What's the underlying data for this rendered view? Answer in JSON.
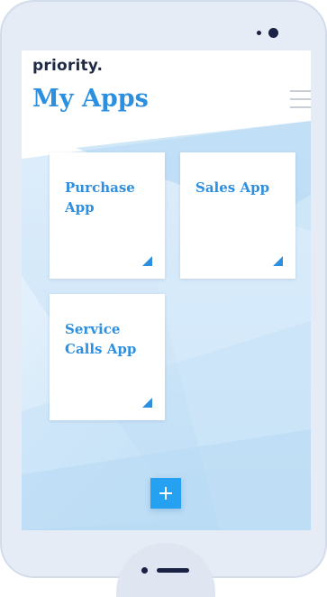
{
  "app": {
    "logo_text": "priority.",
    "page_title": "My Apps"
  },
  "icons": {
    "menu": "hamburger-menu-icon",
    "tile_corner": "corner-triangle-icon",
    "add": "plus-icon"
  },
  "tiles": [
    {
      "label": "Purchase App"
    },
    {
      "label": "Sales App"
    },
    {
      "label": "Service Calls App"
    }
  ],
  "colors": {
    "accent": "#2d8fe0",
    "add_button": "#26a0f0",
    "logo": "#1f2a44",
    "phone_body": "#e6ecf5"
  }
}
